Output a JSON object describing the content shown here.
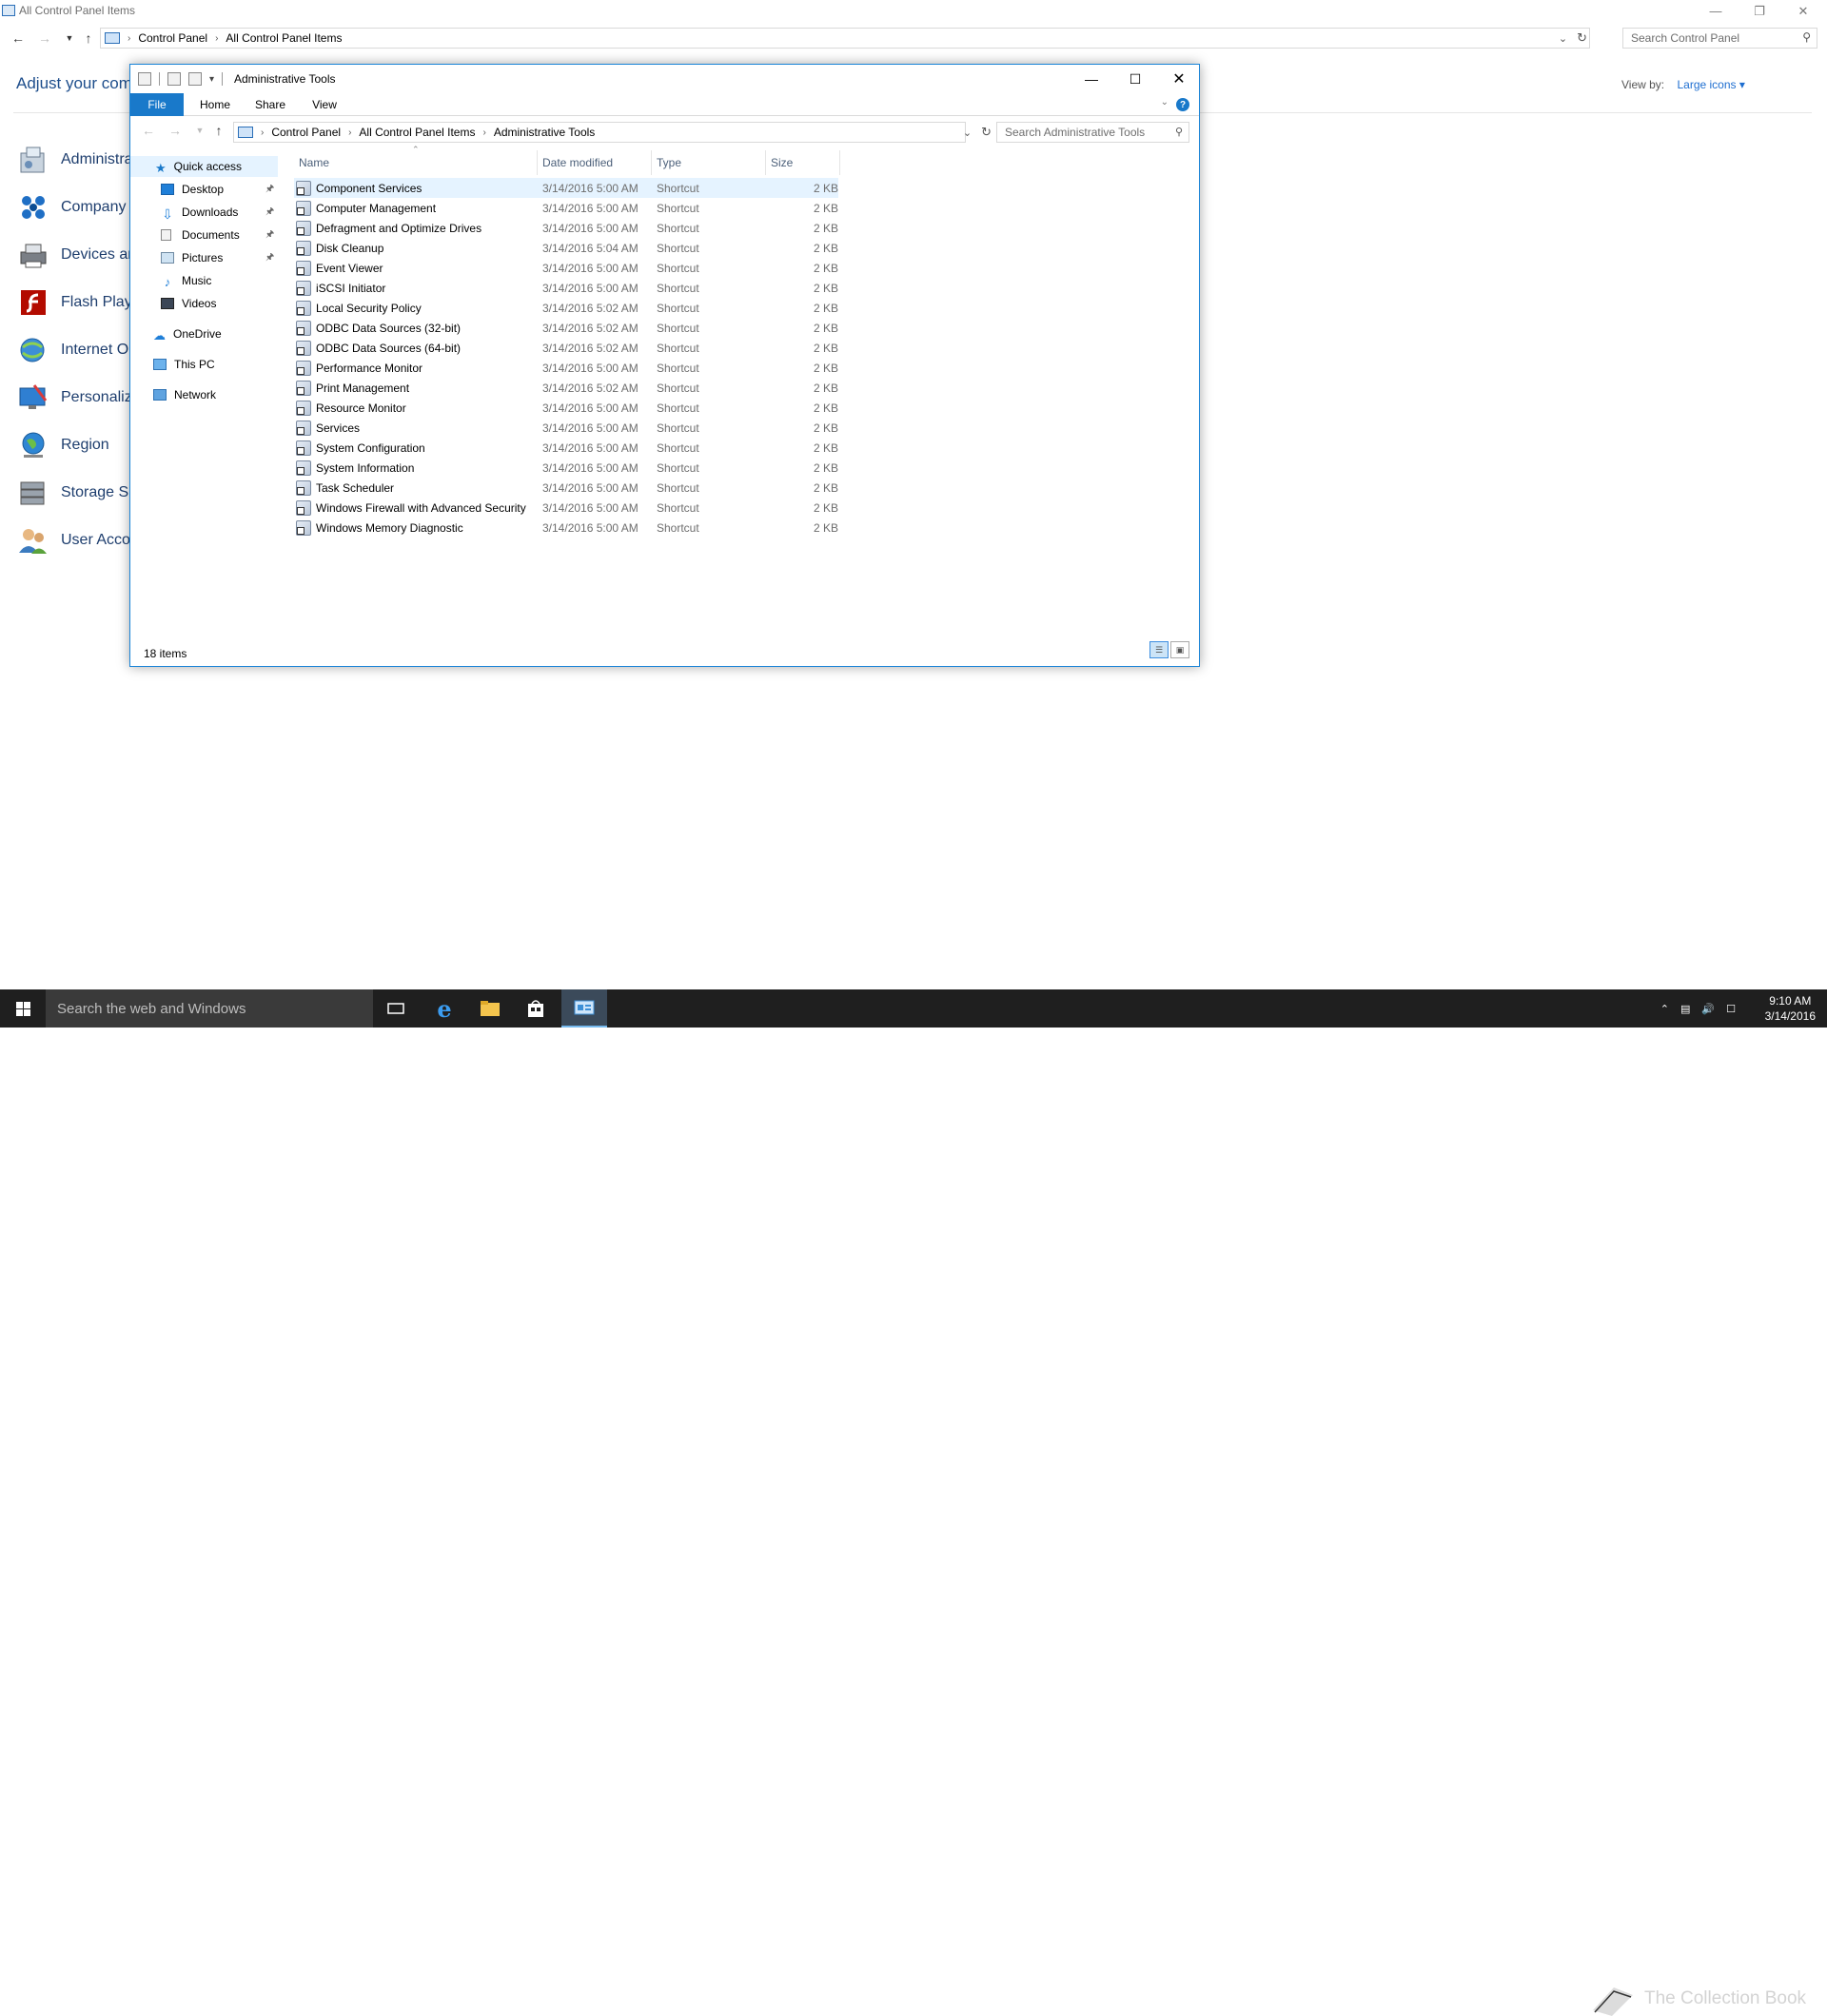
{
  "control_panel": {
    "title": "All Control Panel Items",
    "breadcrumb": [
      "Control Panel",
      "All Control Panel Items"
    ],
    "search_placeholder": "Search Control Panel",
    "heading": "Adjust your comp",
    "view_by_label": "View by:",
    "view_by_value": "Large icons",
    "items": [
      {
        "label": "Administrati",
        "icon": "administrative-tools-icon"
      },
      {
        "label": "Company S",
        "icon": "company-icon"
      },
      {
        "label": "Devices an",
        "icon": "devices-printers-icon"
      },
      {
        "label": "Flash Playe",
        "icon": "flash-player-icon"
      },
      {
        "label": "Internet Op",
        "icon": "internet-options-icon"
      },
      {
        "label": "Personaliza",
        "icon": "personalization-icon"
      },
      {
        "label": "Region",
        "icon": "region-icon"
      },
      {
        "label": "Storage Sp",
        "icon": "storage-spaces-icon"
      },
      {
        "label": "User Accou",
        "icon": "user-accounts-icon"
      }
    ]
  },
  "admin_tools": {
    "title": "Administrative Tools",
    "ribbon_tabs": [
      "File",
      "Home",
      "Share",
      "View"
    ],
    "breadcrumb": [
      "Control Panel",
      "All Control Panel Items",
      "Administrative Tools"
    ],
    "search_placeholder": "Search Administrative Tools",
    "nav": {
      "quick_access": "Quick access",
      "pinned": [
        "Desktop",
        "Downloads",
        "Documents",
        "Pictures"
      ],
      "unpinned": [
        "Music",
        "Videos"
      ],
      "onedrive": "OneDrive",
      "this_pc": "This PC",
      "network": "Network"
    },
    "columns": {
      "name": "Name",
      "date": "Date modified",
      "type": "Type",
      "size": "Size"
    },
    "files": [
      {
        "name": "Component Services",
        "date": "3/14/2016 5:00 AM",
        "type": "Shortcut",
        "size": "2 KB"
      },
      {
        "name": "Computer Management",
        "date": "3/14/2016 5:00 AM",
        "type": "Shortcut",
        "size": "2 KB"
      },
      {
        "name": "Defragment and Optimize Drives",
        "date": "3/14/2016 5:00 AM",
        "type": "Shortcut",
        "size": "2 KB"
      },
      {
        "name": "Disk Cleanup",
        "date": "3/14/2016 5:04 AM",
        "type": "Shortcut",
        "size": "2 KB"
      },
      {
        "name": "Event Viewer",
        "date": "3/14/2016 5:00 AM",
        "type": "Shortcut",
        "size": "2 KB"
      },
      {
        "name": "iSCSI Initiator",
        "date": "3/14/2016 5:00 AM",
        "type": "Shortcut",
        "size": "2 KB"
      },
      {
        "name": "Local Security Policy",
        "date": "3/14/2016 5:02 AM",
        "type": "Shortcut",
        "size": "2 KB"
      },
      {
        "name": "ODBC Data Sources (32-bit)",
        "date": "3/14/2016 5:02 AM",
        "type": "Shortcut",
        "size": "2 KB"
      },
      {
        "name": "ODBC Data Sources (64-bit)",
        "date": "3/14/2016 5:02 AM",
        "type": "Shortcut",
        "size": "2 KB"
      },
      {
        "name": "Performance Monitor",
        "date": "3/14/2016 5:00 AM",
        "type": "Shortcut",
        "size": "2 KB"
      },
      {
        "name": "Print Management",
        "date": "3/14/2016 5:02 AM",
        "type": "Shortcut",
        "size": "2 KB"
      },
      {
        "name": "Resource Monitor",
        "date": "3/14/2016 5:00 AM",
        "type": "Shortcut",
        "size": "2 KB"
      },
      {
        "name": "Services",
        "date": "3/14/2016 5:00 AM",
        "type": "Shortcut",
        "size": "2 KB"
      },
      {
        "name": "System Configuration",
        "date": "3/14/2016 5:00 AM",
        "type": "Shortcut",
        "size": "2 KB"
      },
      {
        "name": "System Information",
        "date": "3/14/2016 5:00 AM",
        "type": "Shortcut",
        "size": "2 KB"
      },
      {
        "name": "Task Scheduler",
        "date": "3/14/2016 5:00 AM",
        "type": "Shortcut",
        "size": "2 KB"
      },
      {
        "name": "Windows Firewall with Advanced Security",
        "date": "3/14/2016 5:00 AM",
        "type": "Shortcut",
        "size": "2 KB"
      },
      {
        "name": "Windows Memory Diagnostic",
        "date": "3/14/2016 5:00 AM",
        "type": "Shortcut",
        "size": "2 KB"
      }
    ],
    "selected_index": 0,
    "status": "18 items"
  },
  "taskbar": {
    "search_placeholder": "Search the web and Windows",
    "clock_time": "9:10 AM",
    "clock_date": "3/14/2016",
    "watermark": "The Collection Book"
  },
  "colors": {
    "accent": "#1979ca",
    "selection": "#e5f3ff",
    "taskbar": "#1f1f1f"
  }
}
